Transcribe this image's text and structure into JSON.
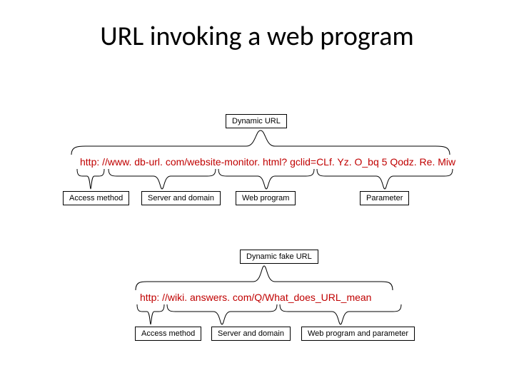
{
  "title": "URL invoking a web program",
  "section1": {
    "dynamic_label": "Dynamic URL",
    "url": "http: //www. db-url. com/website-monitor. html? gclid=CLf. Yz. O_bq 5 Qodz. Re. Miw",
    "access_label": "Access method",
    "server_label": "Server and domain",
    "web_label": "Web program",
    "param_label": "Parameter"
  },
  "section2": {
    "dynamic_label": "Dynamic fake URL",
    "url": "http: //wiki. answers. com/Q/What_does_URL_mean",
    "access_label": "Access method",
    "server_label": "Server and domain",
    "web_label": "Web program and parameter"
  }
}
